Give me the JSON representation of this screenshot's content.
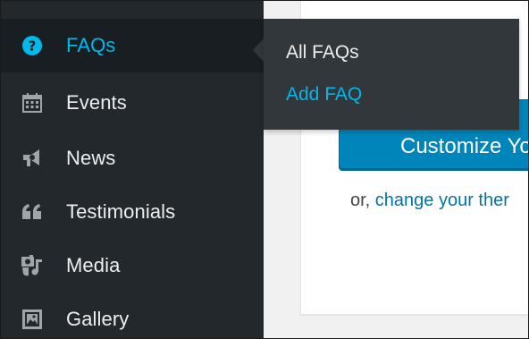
{
  "sidebar": {
    "items": [
      {
        "label": "FAQs",
        "icon": "question-circle-icon",
        "current": true
      },
      {
        "label": "Events",
        "icon": "calendar-icon"
      },
      {
        "label": "News",
        "icon": "megaphone-icon"
      },
      {
        "label": "Testimonials",
        "icon": "quote-icon"
      },
      {
        "label": "Media",
        "icon": "media-icon"
      },
      {
        "label": "Gallery",
        "icon": "gallery-icon"
      }
    ]
  },
  "flyout": {
    "items": [
      {
        "label": "All FAQs"
      },
      {
        "label": "Add FAQ",
        "active": true
      }
    ]
  },
  "content": {
    "button_label": "Customize Yo",
    "or_prefix": "or, ",
    "or_link": "change your ther"
  },
  "colors": {
    "sidebar_bg": "#23282d",
    "accent": "#00b9eb",
    "button_bg": "#0085ba",
    "link": "#0073aa"
  }
}
